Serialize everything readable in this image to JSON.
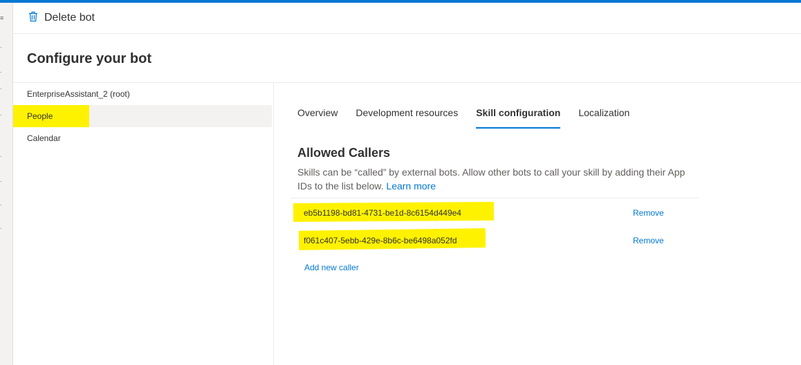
{
  "toolbar": {
    "delete_label": "Delete bot"
  },
  "page": {
    "title": "Configure your bot"
  },
  "sidebar": {
    "items": [
      {
        "label": "EnterpriseAssistant_2 (root)"
      },
      {
        "label": "People"
      },
      {
        "label": "Calendar"
      }
    ]
  },
  "tabs": [
    {
      "label": "Overview"
    },
    {
      "label": "Development resources"
    },
    {
      "label": "Skill configuration"
    },
    {
      "label": "Localization"
    }
  ],
  "allowed_callers": {
    "title": "Allowed Callers",
    "description": "Skills can be “called” by external bots. Allow other bots to call your skill by adding their App IDs to the list below.",
    "learn_more": "Learn more",
    "callers": [
      {
        "id": "eb5b1198-bd81-4731-be1d-8c6154d449e4",
        "action": "Remove"
      },
      {
        "id": "f061c407-5ebb-429e-8b6c-be6498a052fd",
        "action": "Remove"
      }
    ],
    "add_label": "Add new caller"
  },
  "colors": {
    "accent": "#0078d4",
    "highlight": "#fff200"
  }
}
